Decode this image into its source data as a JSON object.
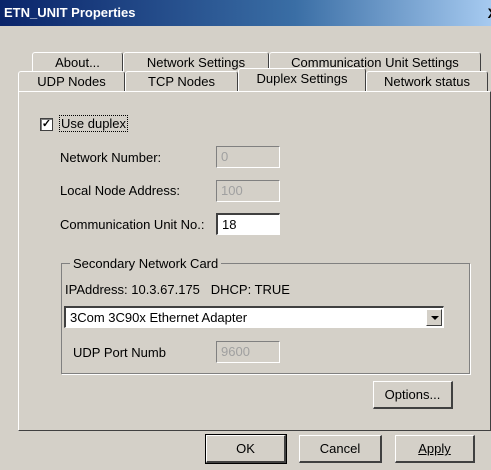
{
  "window": {
    "title": "ETN_UNIT Properties",
    "close_glyph": "X"
  },
  "tabs_row1": [
    {
      "label": "About..."
    },
    {
      "label": "Network Settings"
    },
    {
      "label": "Communication Unit Settings"
    }
  ],
  "tabs_row2": [
    {
      "label": "UDP Nodes"
    },
    {
      "label": "TCP Nodes"
    },
    {
      "label": "Duplex Settings",
      "active": true
    },
    {
      "label": "Network status"
    }
  ],
  "duplex": {
    "use_duplex_label": "Use duplex",
    "use_duplex_checked": true,
    "network_number_label": "Network Number:",
    "network_number_value": "0",
    "local_node_label": "Local Node Address:",
    "local_node_value": "100",
    "comm_unit_label": "Communication Unit No.:",
    "comm_unit_value": "18"
  },
  "secondary": {
    "group_title": "Secondary Network Card",
    "ip_info": "IPAddress: 10.3.67.175   DHCP: TRUE",
    "adapter_selected": "3Com 3C90x Ethernet Adapter",
    "udp_port_label": "UDP Port Numb",
    "udp_port_value": "9600"
  },
  "buttons": {
    "options": "Options...",
    "ok": "OK",
    "cancel": "Cancel",
    "apply": "Apply"
  }
}
